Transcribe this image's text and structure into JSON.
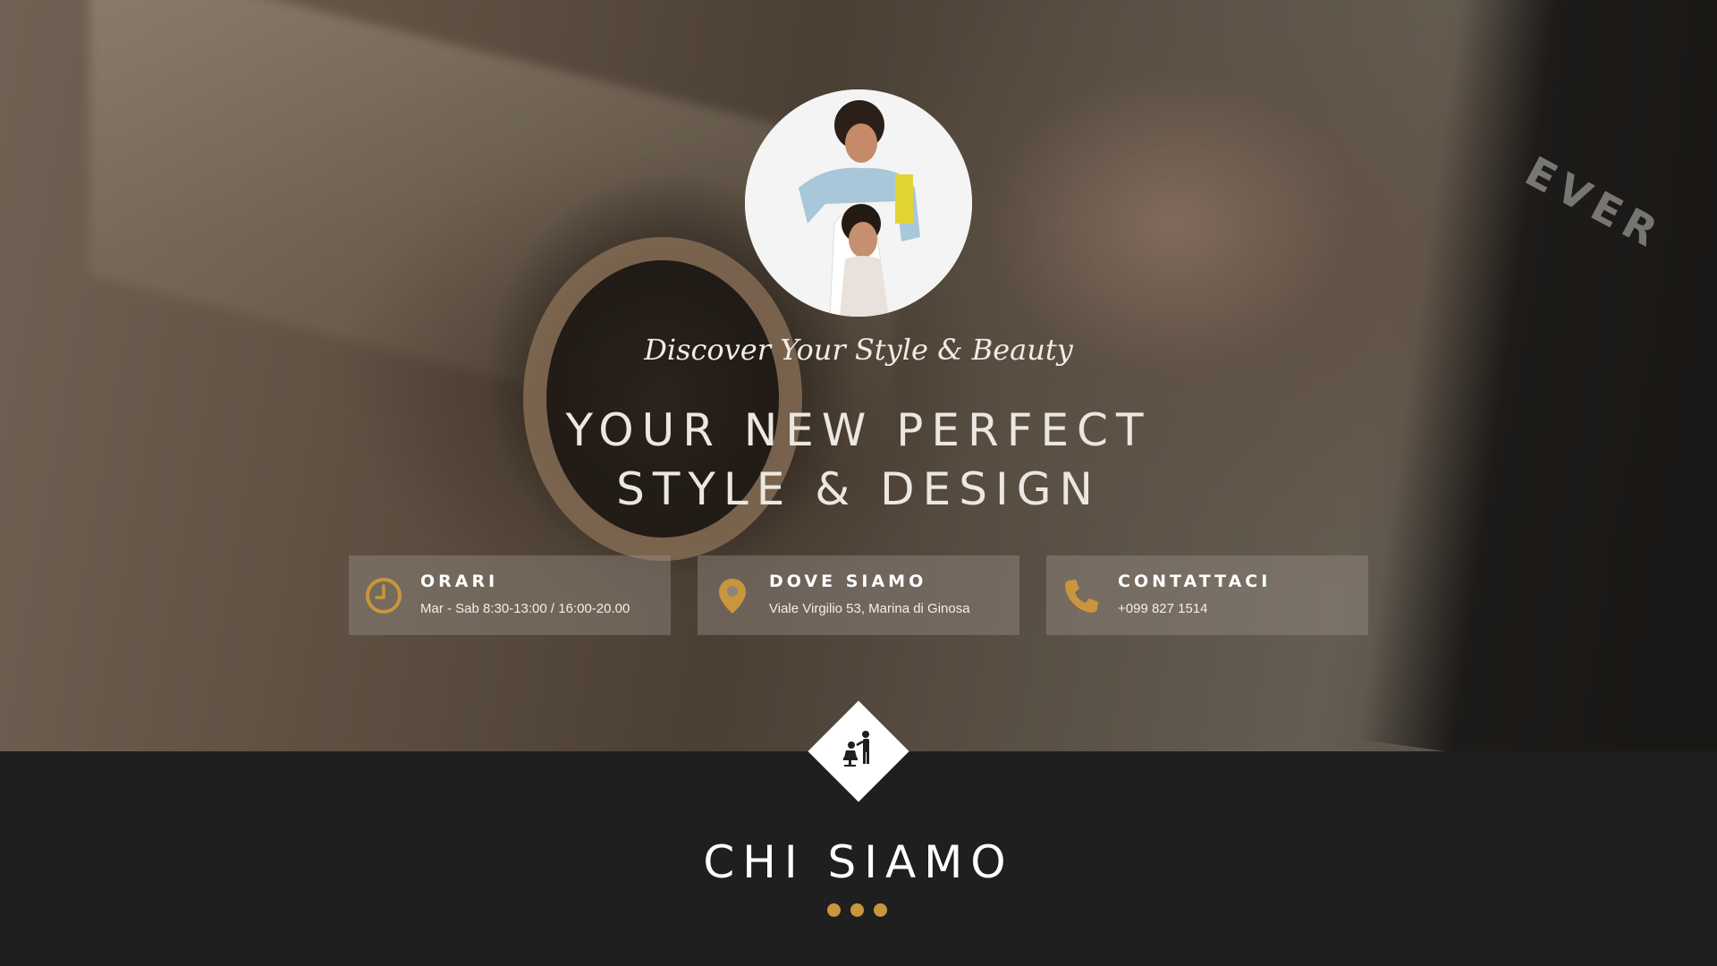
{
  "hero": {
    "background_text": "EVER",
    "tagline": "Discover Your Style & Beauty",
    "headline_line1": "YOUR NEW PERFECT",
    "headline_line2": "STYLE & DESIGN",
    "avatar_icon": "salon-photo"
  },
  "info": [
    {
      "icon": "clock-icon",
      "title": "ORARI",
      "text": "Mar - Sab 8:30-13:00 / 16:00-20.00"
    },
    {
      "icon": "map-pin-icon",
      "title": "DOVE SIAMO",
      "text": "Viale Virgilio 53, Marina di Ginosa"
    },
    {
      "icon": "phone-icon",
      "title": "CONTATTACI",
      "text": "+099 827 1514"
    }
  ],
  "about": {
    "icon": "hairdresser-icon",
    "title": "CHI SIAMO"
  },
  "colors": {
    "accent": "#c9963e",
    "dark_band": "#1f1f1f",
    "card_bg": "rgba(150,140,130,0.45)"
  }
}
